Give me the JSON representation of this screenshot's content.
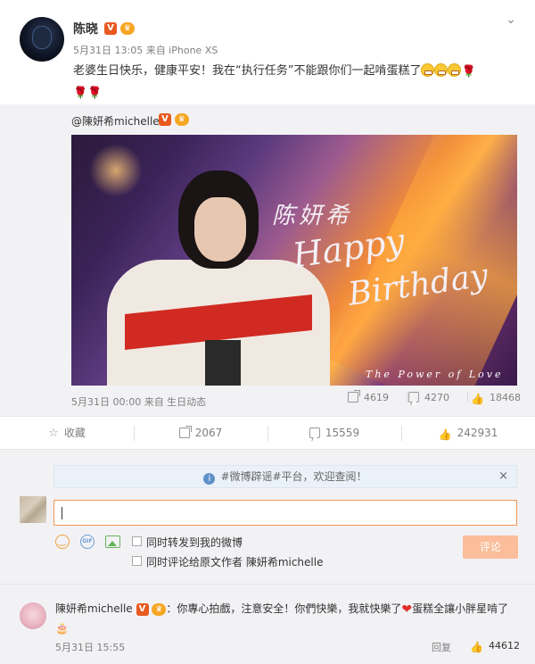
{
  "post": {
    "author": "陈晓",
    "v_badge": "V",
    "meta": "5月31日 13:05 来自 iPhone XS",
    "text_part1": "老婆生日快乐，健康平安！我在“执行任务”不能跟你们一起啃蛋糕了",
    "chevron": "⌄",
    "rose": "🌹"
  },
  "repost": {
    "author": "@陳妍希michelle",
    "v_badge": "V",
    "image": {
      "cn_title": "陈妍希",
      "happy": "Happy",
      "birthday": "Birthday",
      "tagline": "The Power of Love"
    },
    "meta": "5月31日 00:00 来自 生日动态",
    "shares": "4619",
    "comments": "4270",
    "likes": "18468"
  },
  "actions": {
    "favorite": "收藏",
    "share": "2067",
    "comment": "15559",
    "like": "242931"
  },
  "comment_box": {
    "notice": "#微博辟谣#平台，欢迎查阅！",
    "close": "×",
    "checkbox1": "同时转发到我的微博",
    "checkbox2": "同时评论给原文作者 陳妍希michelle",
    "submit": "评论",
    "gif_label": "GIF"
  },
  "reply": {
    "author": "陳妍希michelle",
    "v_badge": "V",
    "text_a": "：你專心拍戲，注意安全！你們快樂，我就快樂了",
    "text_b": "蛋糕全讓小胖星啃了",
    "time": "5月31日 15:55",
    "reply_label": "回复",
    "likes": "44612"
  },
  "colors": {
    "accent": "#f29554",
    "v_badge": "#e8591f",
    "notice_bg": "#eaf1f8",
    "page_grey": "#f2f2f5"
  },
  "icons": [
    "chevron-down-icon",
    "grin-emoji-icon",
    "rose-emoji-icon",
    "share-icon",
    "comment-icon",
    "like-icon",
    "star-icon",
    "info-icon",
    "close-icon",
    "emoji-icon",
    "gif-icon",
    "picture-icon",
    "heart-emoji-icon",
    "cake-emoji-icon"
  ]
}
